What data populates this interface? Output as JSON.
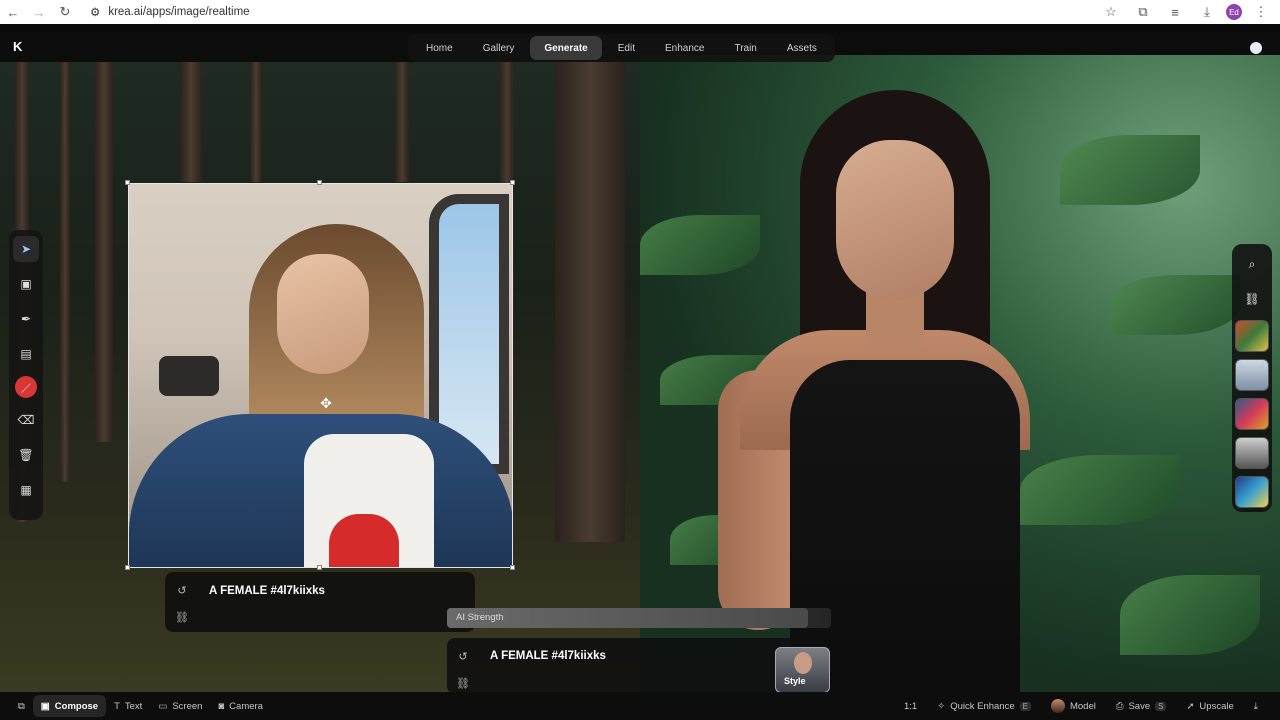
{
  "browser": {
    "url": "krea.ai/apps/image/realtime",
    "avatar_initials": "Ed"
  },
  "nav": {
    "items": [
      {
        "label": "Home"
      },
      {
        "label": "Gallery"
      },
      {
        "label": "Generate",
        "active": true
      },
      {
        "label": "Edit"
      },
      {
        "label": "Enhance"
      },
      {
        "label": "Train"
      },
      {
        "label": "Assets"
      }
    ]
  },
  "logo": "K",
  "left_prompt": {
    "text": "A FEMALE #4l7kiixks"
  },
  "ai_strength": {
    "label": "AI Strength",
    "value": 0.94
  },
  "main_prompt": {
    "text": "A FEMALE #4l7kiixks",
    "style_label": "Style"
  },
  "bottom_bar": {
    "compose": "Compose",
    "text": "Text",
    "screen": "Screen",
    "camera": "Camera",
    "ratio": "1:1",
    "quick_enhance": "Quick Enhance",
    "quick_enhance_key": "E",
    "model": "Model",
    "save": "Save",
    "save_key": "S",
    "upscale": "Upscale"
  },
  "colors": {
    "accent_active_tool": "#9cc2ff",
    "brush_color": "#d93636"
  }
}
